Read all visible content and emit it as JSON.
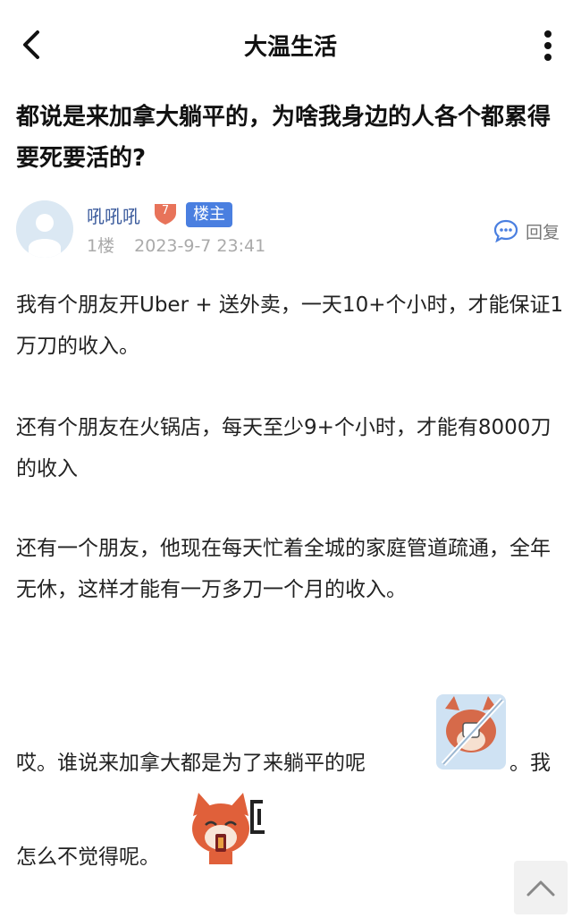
{
  "header": {
    "title": "大温生活",
    "back_icon": "chevron-left-icon",
    "more_icon": "more-vertical-icon"
  },
  "post": {
    "title": "都说是来加拿大躺平的，为啥我身边的人各个都累得要死要活的?",
    "author": {
      "name": "吼吼吼",
      "level": "7",
      "role_badge": "楼主"
    },
    "floor": "1楼",
    "timestamp": "2023-9-7 23:41",
    "reply_label": "回复",
    "paragraphs": [
      "我有个朋友开Uber + 送外卖，一天10+个小时，才能保证1万刀的收入。",
      "还有个朋友在火锅店，每天至少9+个小时，才能有8000刀的收入",
      "还有一个朋友，他现在每天忙着全城的家庭管道疏通，全年无休，这样才能有一万多刀一个月的收入。",
      "哎。谁说来加拿大都是为了来躺平的呢",
      "。我",
      "怎么不觉得呢。"
    ]
  },
  "colors": {
    "accent": "#4a7fe0",
    "level_badge": "#e8735a",
    "username": "#3a5a9c",
    "meta": "#aaaaaa"
  }
}
